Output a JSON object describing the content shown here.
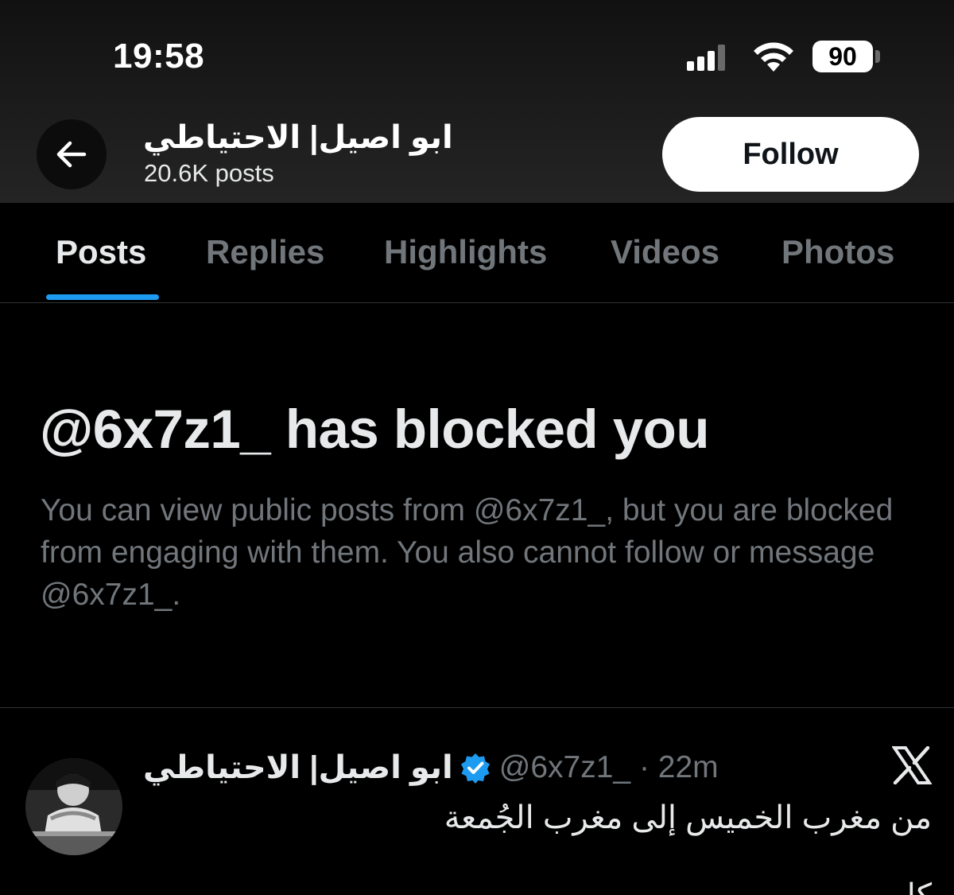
{
  "status_bar": {
    "time": "19:58",
    "battery_level": "90",
    "icons": [
      "signal-icon",
      "wifi-icon",
      "battery-icon"
    ]
  },
  "profile_header": {
    "back_icon": "arrow-left-icon",
    "display_name": "ابو اصيل| الاحتياطي",
    "post_count": "20.6K posts",
    "follow_label": "Follow"
  },
  "tabs": [
    {
      "label": "Posts",
      "active": true
    },
    {
      "label": "Replies",
      "active": false
    },
    {
      "label": "Highlights",
      "active": false
    },
    {
      "label": "Videos",
      "active": false
    },
    {
      "label": "Photos",
      "active": false
    }
  ],
  "blocked": {
    "title": "@6x7z1_ has blocked you",
    "description": "You can view public posts from @6x7z1_, but you are blocked from engaging with them. You also cannot follow or message @6x7z1_."
  },
  "post": {
    "author": "ابو اصيل| الاحتياطي",
    "handle_time": "@6x7z1_ · 22m",
    "verified_icon": "verified-badge-icon",
    "source_icon": "x-logo-icon",
    "text": "من مغرب الخميس إلى مغرب الجُمعة",
    "text_continued": "كل"
  },
  "colors": {
    "accent": "#1d9bf0",
    "background": "#000000",
    "muted_text": "#71767b",
    "primary_text": "#e7e9ea"
  }
}
